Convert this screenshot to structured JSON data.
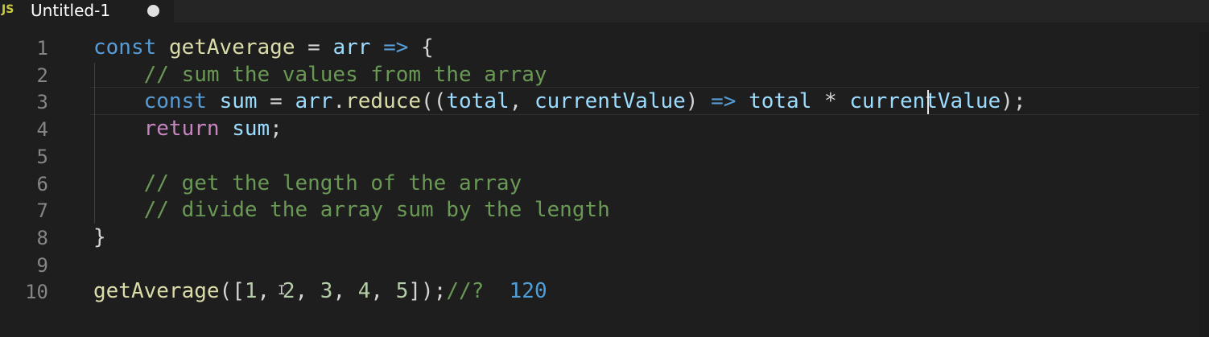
{
  "tab": {
    "icon_text": "JS",
    "title": "Untitled-1",
    "dirty": true
  },
  "lines": [
    {
      "number": "1",
      "tokens": [
        [
          "k",
          "const"
        ],
        [
          "p",
          " "
        ],
        [
          "f",
          "getAverage"
        ],
        [
          "p",
          " = "
        ],
        [
          "v",
          "arr"
        ],
        [
          "p",
          " "
        ],
        [
          "k",
          "=>"
        ],
        [
          "p",
          " {"
        ]
      ]
    },
    {
      "number": "2",
      "tokens": [
        [
          "p",
          "    "
        ],
        [
          "c",
          "// sum the values from the array"
        ]
      ]
    },
    {
      "number": "3",
      "tokens": [
        [
          "p",
          "    "
        ],
        [
          "k",
          "const"
        ],
        [
          "p",
          " "
        ],
        [
          "v",
          "sum"
        ],
        [
          "p",
          " = "
        ],
        [
          "v",
          "arr"
        ],
        [
          "p",
          "."
        ],
        [
          "f",
          "reduce"
        ],
        [
          "p",
          "(("
        ],
        [
          "v",
          "total"
        ],
        [
          "p",
          ", "
        ],
        [
          "v",
          "currentValue"
        ],
        [
          "p",
          ") "
        ],
        [
          "k",
          "=>"
        ],
        [
          "p",
          " "
        ],
        [
          "v",
          "total"
        ],
        [
          "p",
          " * "
        ],
        [
          "v",
          "currentValue"
        ],
        [
          "p",
          ");"
        ]
      ]
    },
    {
      "number": "4",
      "tokens": [
        [
          "p",
          "    "
        ],
        [
          "r",
          "return"
        ],
        [
          "p",
          " "
        ],
        [
          "v",
          "sum"
        ],
        [
          "p",
          ";"
        ]
      ]
    },
    {
      "number": "5",
      "tokens": []
    },
    {
      "number": "6",
      "tokens": [
        [
          "p",
          "    "
        ],
        [
          "c",
          "// get the length of the array"
        ]
      ]
    },
    {
      "number": "7",
      "tokens": [
        [
          "p",
          "    "
        ],
        [
          "c",
          "// divide the array sum by the length"
        ]
      ]
    },
    {
      "number": "8",
      "tokens": [
        [
          "p",
          "}"
        ]
      ]
    },
    {
      "number": "9",
      "tokens": []
    },
    {
      "number": "10",
      "tokens": [
        [
          "f",
          "getAverage"
        ],
        [
          "p",
          "(["
        ],
        [
          "n",
          "1"
        ],
        [
          "p",
          ", "
        ],
        [
          "n",
          "2"
        ],
        [
          "p",
          ", "
        ],
        [
          "n",
          "3"
        ],
        [
          "p",
          ", "
        ],
        [
          "n",
          "4"
        ],
        [
          "p",
          ", "
        ],
        [
          "n",
          "5"
        ],
        [
          "p",
          "]);"
        ],
        [
          "c",
          "//?"
        ],
        [
          "p",
          "  "
        ],
        [
          "res",
          "120"
        ]
      ]
    }
  ]
}
